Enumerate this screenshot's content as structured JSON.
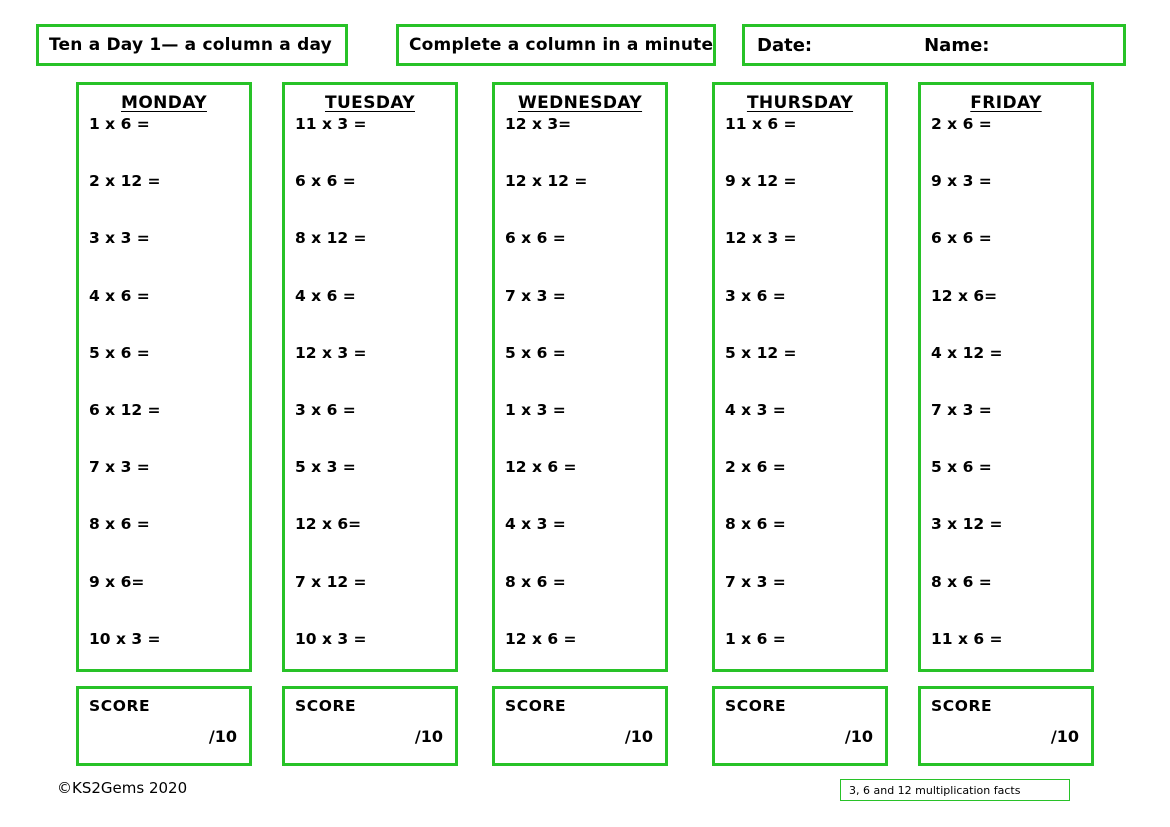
{
  "theme": {
    "border_color": "#28c228",
    "text_color": "#000000",
    "background": "#ffffff"
  },
  "header": {
    "title": "Ten a Day 1— a column a day",
    "subtitle": "Complete a column in a minute",
    "date_label": "Date:",
    "name_label": "Name:"
  },
  "columns": [
    {
      "day": "MONDAY",
      "questions": [
        "1 x 6 =",
        "2 x 12 =",
        "3 x 3 =",
        "4 x 6 =",
        "5 x 6 =",
        "6 x 12 =",
        "7 x 3 =",
        "8 x 6 =",
        "9 x 6=",
        "10 x 3 ="
      ],
      "score_label": "SCORE",
      "score_out_of": "/10"
    },
    {
      "day": "TUESDAY",
      "questions": [
        "11 x 3 =",
        "6 x 6 =",
        "8 x 12 =",
        "4 x 6 =",
        "12 x 3 =",
        "3 x 6 =",
        "5 x 3 =",
        "12 x 6=",
        "7 x 12 =",
        "10 x 3 ="
      ],
      "score_label": "SCORE",
      "score_out_of": "/10"
    },
    {
      "day": "WEDNESDAY",
      "questions": [
        "12 x 3=",
        "12 x 12 =",
        "6 x 6 =",
        "7 x 3 =",
        "5 x 6 =",
        "1 x 3 =",
        "12 x 6 =",
        "4 x 3 =",
        "8 x 6 =",
        "12 x 6 ="
      ],
      "score_label": "SCORE",
      "score_out_of": "/10"
    },
    {
      "day": "THURSDAY",
      "questions": [
        "11 x 6 =",
        "9 x 12 =",
        "12 x 3 =",
        "3 x 6 =",
        "5 x 12 =",
        "4 x 3 =",
        "2 x 6 =",
        "8 x 6 =",
        "7 x 3 =",
        "1 x 6 ="
      ],
      "score_label": "SCORE",
      "score_out_of": "/10"
    },
    {
      "day": "FRIDAY",
      "questions": [
        "2 x 6 =",
        "9 x 3 =",
        "6 x 6 =",
        "12 x 6=",
        "4 x 12 =",
        "7 x 3 =",
        "5 x 6 =",
        "3 x 12 =",
        "8 x 6 =",
        "11 x 6 ="
      ],
      "score_label": "SCORE",
      "score_out_of": "/10"
    }
  ],
  "footer": {
    "copyright": "©KS2Gems 2020",
    "facts_note": "3, 6 and 12 multiplication facts"
  }
}
